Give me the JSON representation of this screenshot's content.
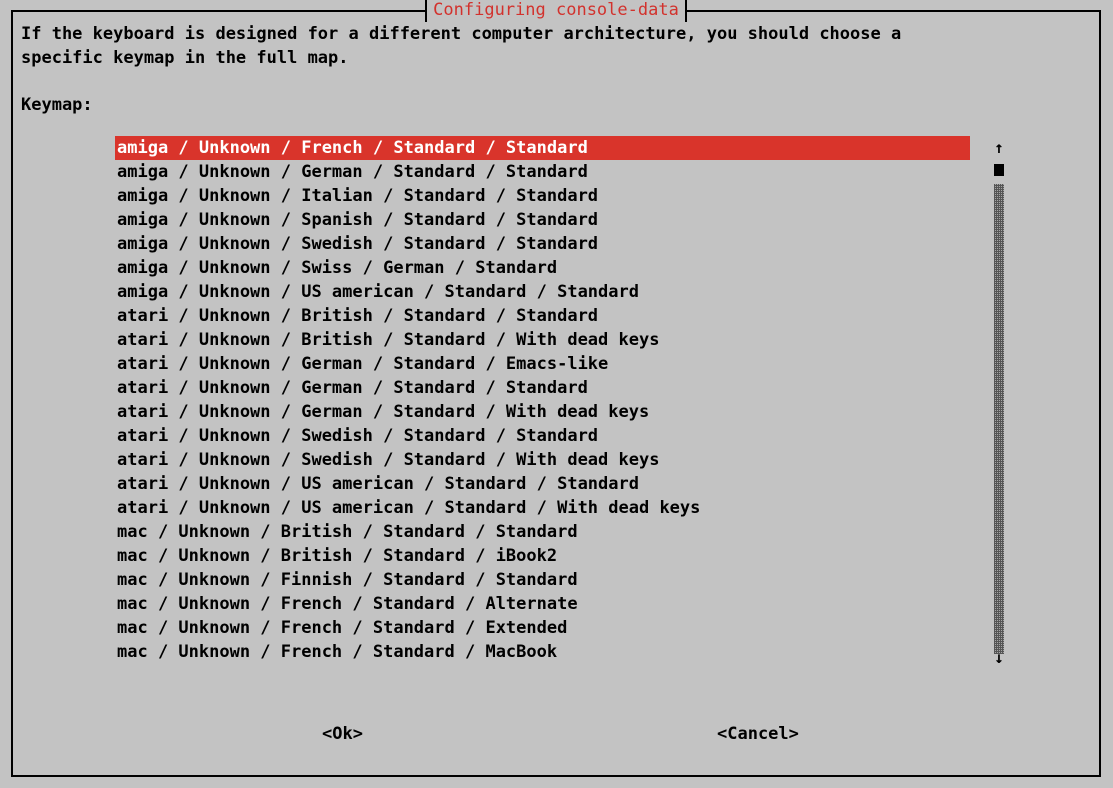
{
  "dialog": {
    "title": "Configuring console-data",
    "message": "If the keyboard is designed for a different computer architecture, you should choose a\nspecific keymap in the full map.",
    "prompt": "Keymap:"
  },
  "keymaps": {
    "selected_index": 0,
    "items": [
      "amiga / Unknown / French / Standard / Standard",
      "amiga / Unknown / German / Standard / Standard",
      "amiga / Unknown / Italian / Standard / Standard",
      "amiga / Unknown / Spanish / Standard / Standard",
      "amiga / Unknown / Swedish / Standard / Standard",
      "amiga / Unknown / Swiss / German / Standard",
      "amiga / Unknown / US american / Standard / Standard",
      "atari / Unknown / British / Standard / Standard",
      "atari / Unknown / British / Standard / With dead keys",
      "atari / Unknown / German / Standard / Emacs-like",
      "atari / Unknown / German / Standard / Standard",
      "atari / Unknown / German / Standard / With dead keys",
      "atari / Unknown / Swedish / Standard / Standard",
      "atari / Unknown / Swedish / Standard / With dead keys",
      "atari / Unknown / US american / Standard / Standard",
      "atari / Unknown / US american / Standard / With dead keys",
      "mac / Unknown / British / Standard / Standard",
      "mac / Unknown / British / Standard / iBook2",
      "mac / Unknown / Finnish / Standard / Standard",
      "mac / Unknown / French / Standard / Alternate",
      "mac / Unknown / French / Standard / Extended",
      "mac / Unknown / French / Standard / MacBook"
    ]
  },
  "scrollbar": {
    "up_arrow": "↑",
    "down_arrow": "↓",
    "position": 0.0
  },
  "buttons": {
    "ok_label": "<Ok>",
    "cancel_label": "<Cancel>"
  },
  "colors": {
    "background": "#c3c3c3",
    "title": "#d2322d",
    "selection": "#d9342b",
    "selection_text": "#ffffff"
  }
}
